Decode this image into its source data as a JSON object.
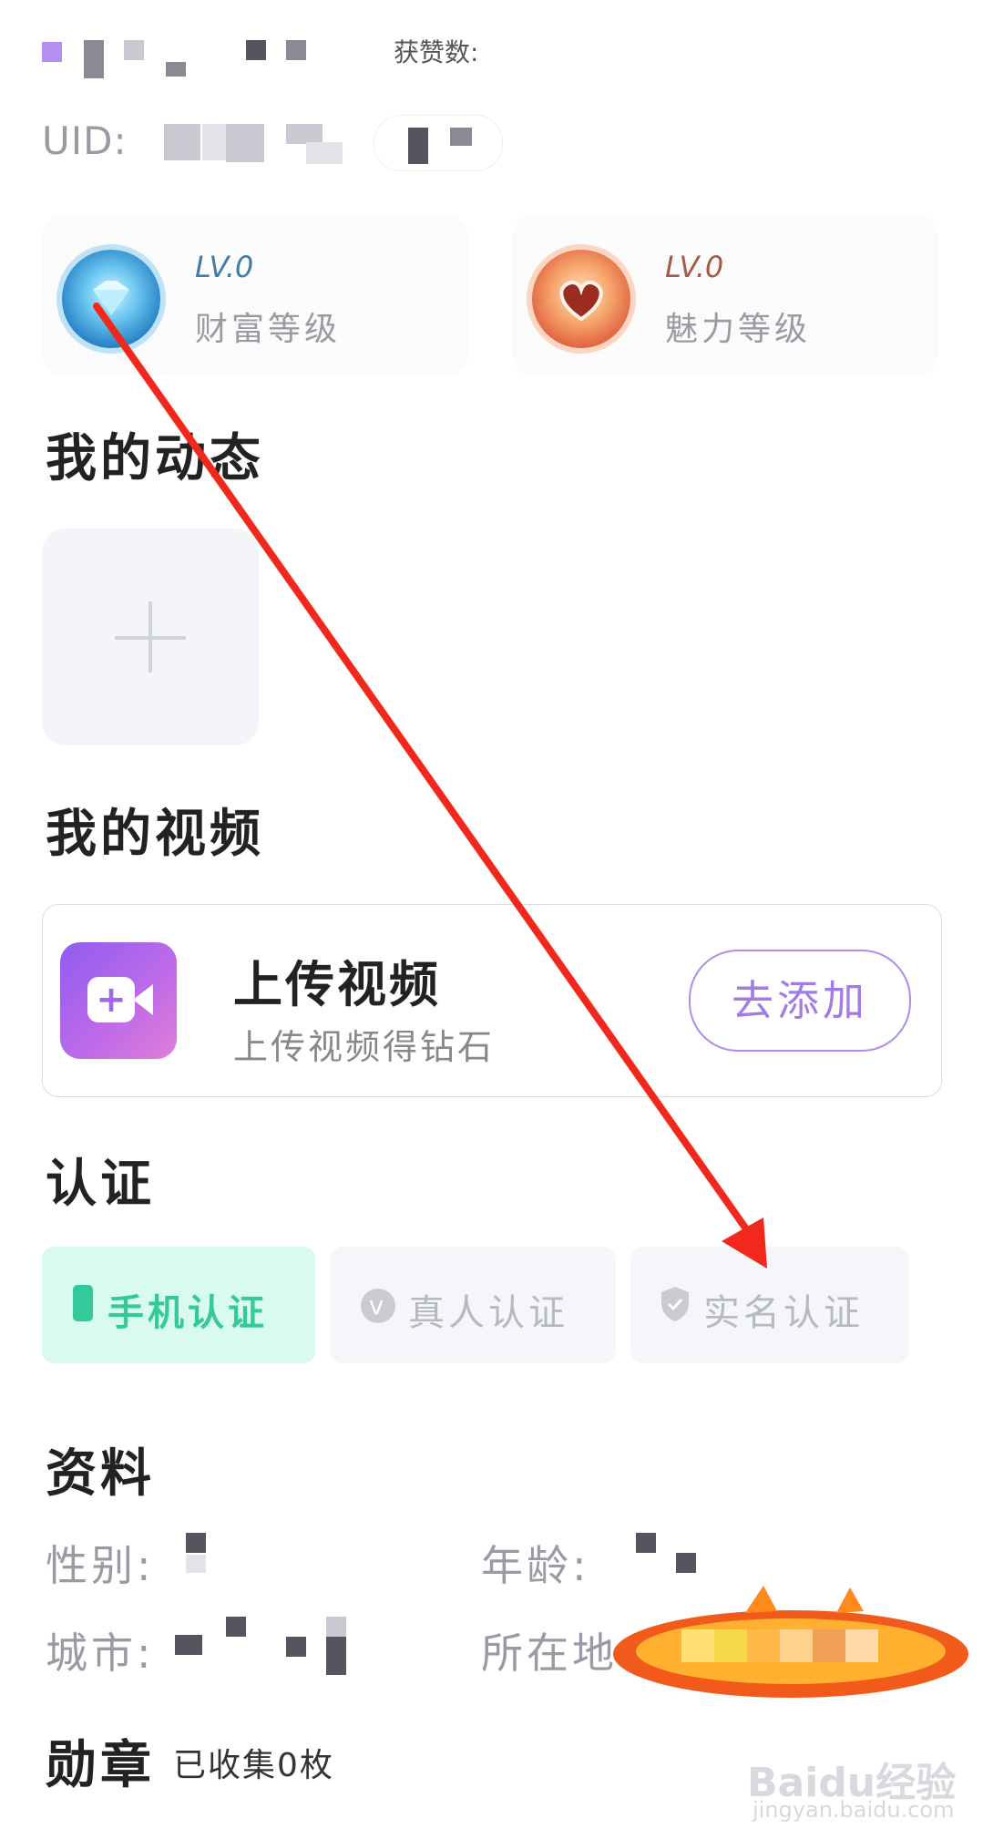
{
  "header": {
    "likes_label": "获赞数:",
    "uid_label": "UID:"
  },
  "levels": [
    {
      "level": "LV.0",
      "name": "财富等级",
      "icon": "diamond-badge-icon",
      "color": "#3d7ea6"
    },
    {
      "level": "LV.0",
      "name": "魅力等级",
      "icon": "heart-badge-icon",
      "color": "#a45a4a"
    }
  ],
  "sections": {
    "moments_title": "我的动态",
    "videos_title": "我的视频",
    "cert_title": "认证",
    "profile_title": "资料",
    "badges_title": "勋章"
  },
  "video_card": {
    "title": "上传视频",
    "subtitle": "上传视频得钻石",
    "button": "去添加",
    "icon": "video-camera-icon"
  },
  "certifications": [
    {
      "label": "手机认证",
      "icon": "phone-icon",
      "active": true
    },
    {
      "label": "真人认证",
      "icon": "v-check-icon",
      "active": false
    },
    {
      "label": "实名认证",
      "icon": "shield-icon",
      "active": false
    }
  ],
  "profile": {
    "gender_label": "性别:",
    "age_label": "年龄:",
    "city_label": "城市:",
    "location_label": "所在地:"
  },
  "badges": {
    "collected": "已收集0枚"
  },
  "watermark": {
    "brand": "Baidu经验",
    "url": "jingyan.baidu.com"
  },
  "colors": {
    "accent_purple": "#a37be8",
    "cert_green": "#34c99a",
    "arrow_red": "#f2281d"
  }
}
